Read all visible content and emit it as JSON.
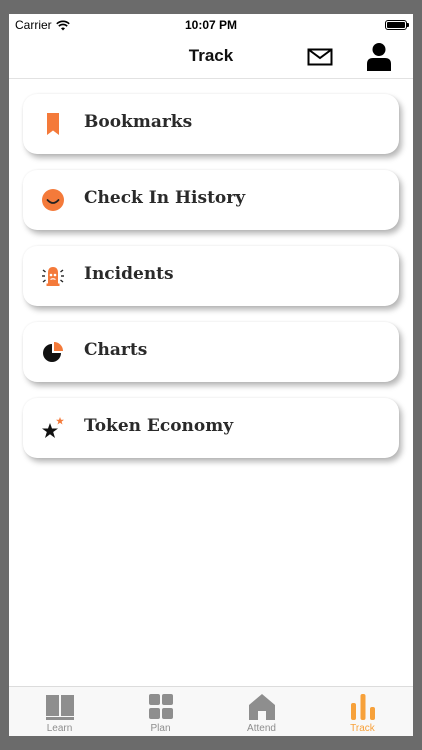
{
  "status_bar": {
    "carrier": "Carrier",
    "time": "10:07 PM"
  },
  "nav": {
    "title": "Track",
    "mail_icon": "envelope-icon",
    "profile_icon": "person-icon"
  },
  "cards": [
    {
      "label": "Bookmarks",
      "icon": "bookmark-icon"
    },
    {
      "label": "Check In History",
      "icon": "smiley-icon"
    },
    {
      "label": "Incidents",
      "icon": "alarm-icon"
    },
    {
      "label": "Charts",
      "icon": "pie-chart-icon"
    },
    {
      "label": "Token Economy",
      "icon": "star-icon"
    }
  ],
  "tabs": [
    {
      "label": "Learn",
      "icon": "book-icon",
      "active": false
    },
    {
      "label": "Plan",
      "icon": "grid-icon",
      "active": false
    },
    {
      "label": "Attend",
      "icon": "house-icon",
      "active": false
    },
    {
      "label": "Track",
      "icon": "bar-chart-icon",
      "active": true
    }
  ],
  "colors": {
    "accent": "#f47a3a",
    "tab_active": "#f7a13a",
    "tab_inactive": "#8e8e8e",
    "card_text": "#2a2a2a"
  }
}
